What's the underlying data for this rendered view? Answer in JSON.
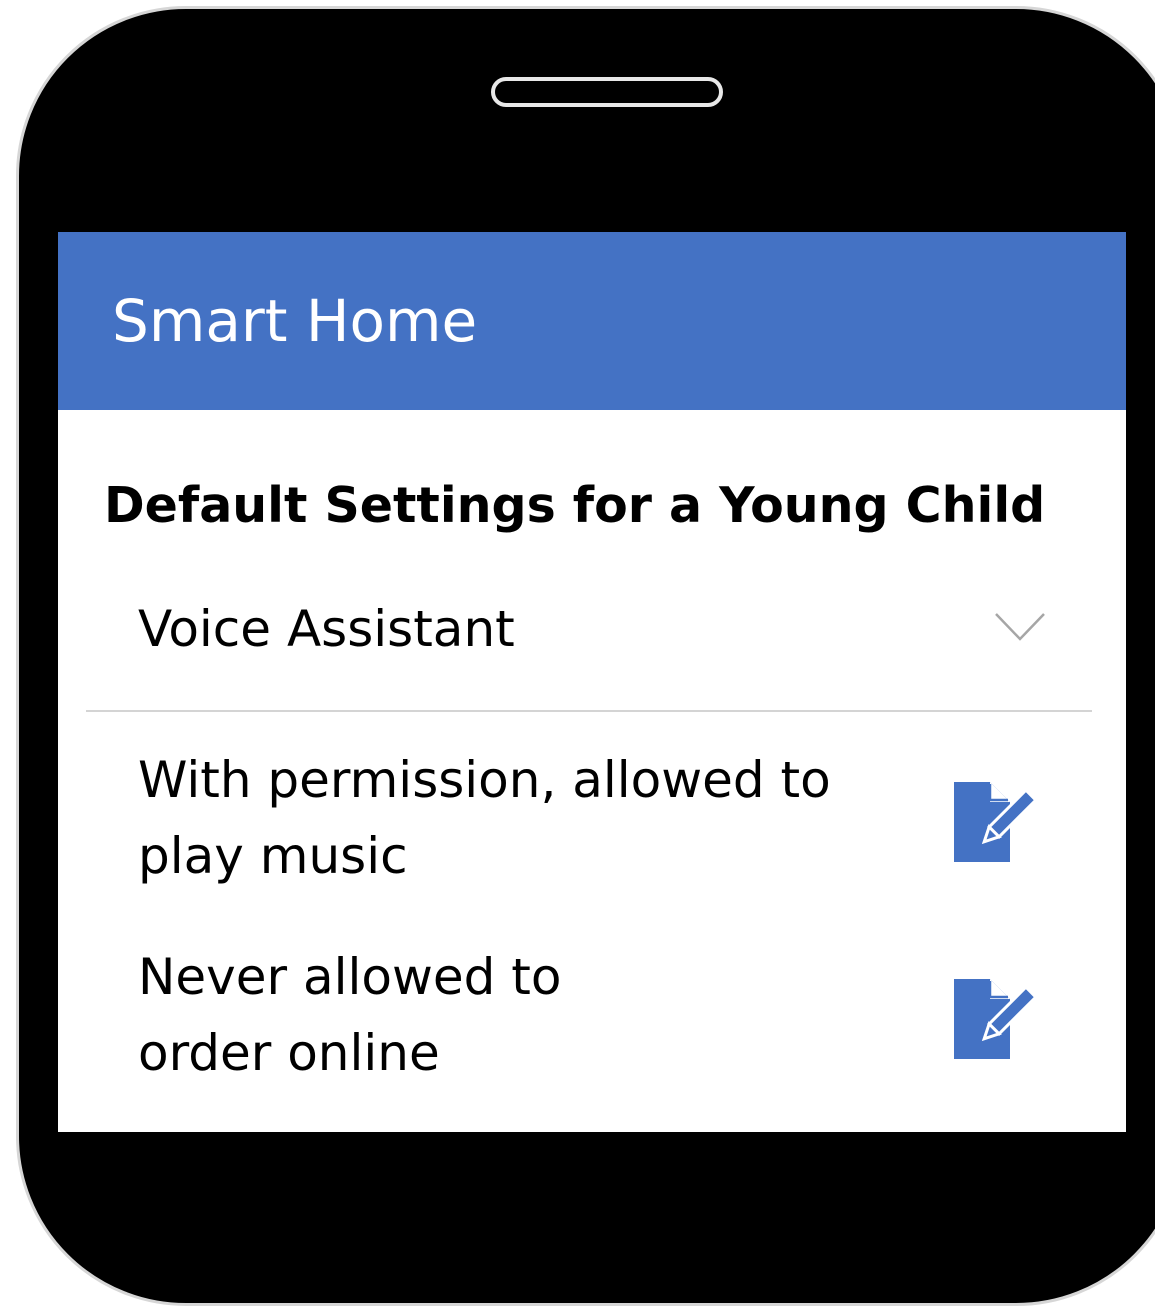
{
  "app": {
    "title": "Smart Home",
    "header_color": "#4472c4",
    "accent_color": "#4472c4"
  },
  "section": {
    "title": "Default Settings for a Young Child"
  },
  "dropdown": {
    "label": "Voice Assistant",
    "icon": "chevron-down-icon"
  },
  "settings": [
    {
      "text": "With permission, allowed to play music",
      "icon": "edit-document-icon"
    },
    {
      "text_line1": "Never allowed to",
      "text_line2": "order online",
      "icon": "edit-document-icon"
    }
  ]
}
